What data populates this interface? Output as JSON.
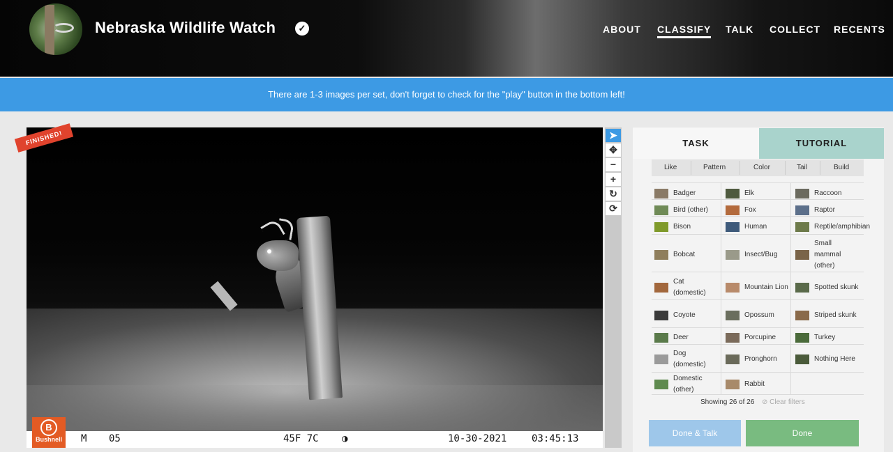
{
  "header": {
    "title": "Nebraska Wildlife Watch",
    "verified_glyph": "✓",
    "nav": [
      "ABOUT",
      "CLASSIFY",
      "TALK",
      "COLLECT",
      "RECENTS"
    ]
  },
  "banner": {
    "text": "There are 1-3 images per set, don't forget to check for the \"play\" button in the bottom left!"
  },
  "viewer": {
    "finished_label": "FINISHED!",
    "brand_initial": "B",
    "brand_name": "Bushnell",
    "stamp": {
      "mode": "M",
      "number": "05",
      "temperature": "45F 7C",
      "moon": "◑",
      "date": "10-30-2021",
      "time": "03:45:13"
    }
  },
  "tools": {
    "pointer": "➤",
    "move": "✥",
    "zoom_out": "−",
    "zoom_in": "+",
    "rotate": "↻",
    "reset": "⟳"
  },
  "panel": {
    "tabs": [
      "TASK",
      "TUTORIAL"
    ],
    "filters": [
      "Like",
      "Pattern",
      "Color",
      "Tail",
      "Build"
    ],
    "choices": [
      {
        "label": "Badger",
        "color": "#8a7a66"
      },
      {
        "label": "Elk",
        "color": "#4e5a3e"
      },
      {
        "label": "Raccoon",
        "color": "#6b6a5e"
      },
      {
        "label": "Bird (other)",
        "color": "#6f8a56"
      },
      {
        "label": "Fox",
        "color": "#b36a3c"
      },
      {
        "label": "Raptor",
        "color": "#5c6f8a"
      },
      {
        "label": "Bison",
        "color": "#7f9a2a"
      },
      {
        "label": "Human",
        "color": "#3e5a7a"
      },
      {
        "label": "Reptile/amphibian",
        "color": "#6d7a4a"
      },
      {
        "label": "Bobcat",
        "color": "#8f7e5c"
      },
      {
        "label": "Insect/Bug",
        "color": "#9a9a8a"
      },
      {
        "label": "Small mammal (other)",
        "color": "#7a6448"
      },
      {
        "label": "Cat (domestic)",
        "color": "#a2673c"
      },
      {
        "label": "Mountain Lion",
        "color": "#b88a6a"
      },
      {
        "label": "Spotted skunk",
        "color": "#5a6a4a"
      },
      {
        "label": "Coyote",
        "color": "#3a3a3a"
      },
      {
        "label": "Opossum",
        "color": "#6a6e5e"
      },
      {
        "label": "Striped skunk",
        "color": "#8a6a4a"
      },
      {
        "label": "Deer",
        "color": "#5a7a4a"
      },
      {
        "label": "Porcupine",
        "color": "#7a6a5a"
      },
      {
        "label": "Turkey",
        "color": "#4a6a3a"
      },
      {
        "label": "Dog (domestic)",
        "color": "#9a9a9a"
      },
      {
        "label": "Pronghorn",
        "color": "#6a6a5a"
      },
      {
        "label": "Nothing Here",
        "color": "#4a5a3a"
      },
      {
        "label": "Domestic (other)",
        "color": "#5e8a4e"
      },
      {
        "label": "Rabbit",
        "color": "#a88a6a"
      }
    ],
    "showing": "Showing 26 of 26",
    "clear_filters": "⊘ Clear filters",
    "buttons": {
      "done_talk": "Done & Talk",
      "done": "Done"
    }
  },
  "colors": {
    "banner": "#3d9ae4",
    "finished": "#e0432d",
    "tutorial_tab": "#a9d3cc",
    "done_talk": "#9ec7ea",
    "done": "#79bb80",
    "brand": "#e35b24"
  }
}
